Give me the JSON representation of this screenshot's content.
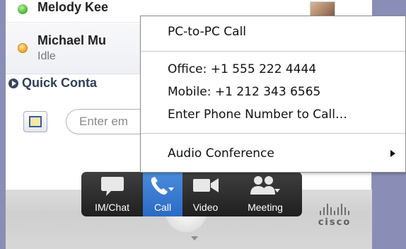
{
  "contacts": [
    {
      "name": "Melody Kee",
      "status": "",
      "presence": "available"
    },
    {
      "name": "Michael Mu",
      "status": "Idle",
      "presence": "idle"
    }
  ],
  "quick_contacts": {
    "label": "Quick Conta",
    "icon": "circle-arrow-icon"
  },
  "search": {
    "placeholder": "Enter em",
    "value": ""
  },
  "toolbar": {
    "items": [
      {
        "label": "IM/Chat",
        "icon": "chat-bubble-icon"
      },
      {
        "label": "Call",
        "icon": "phone-icon",
        "active": true
      },
      {
        "label": "Video",
        "icon": "video-camera-icon"
      },
      {
        "label": "Meeting",
        "icon": "people-icon"
      }
    ]
  },
  "context_menu": {
    "pc_call": "PC-to-PC Call",
    "office": "Office: +1 555 222 4444",
    "mobile": "Mobile: +1 212 343 6565",
    "enter_number": "Enter Phone Number to Call…",
    "audio_conference": "Audio Conference"
  },
  "brand": {
    "logo_text": "cisco"
  },
  "colors": {
    "accent": "#3a7bd5",
    "available": "#42b22a",
    "idle": "#f0a020",
    "toolbar": "#2a2a2a"
  }
}
